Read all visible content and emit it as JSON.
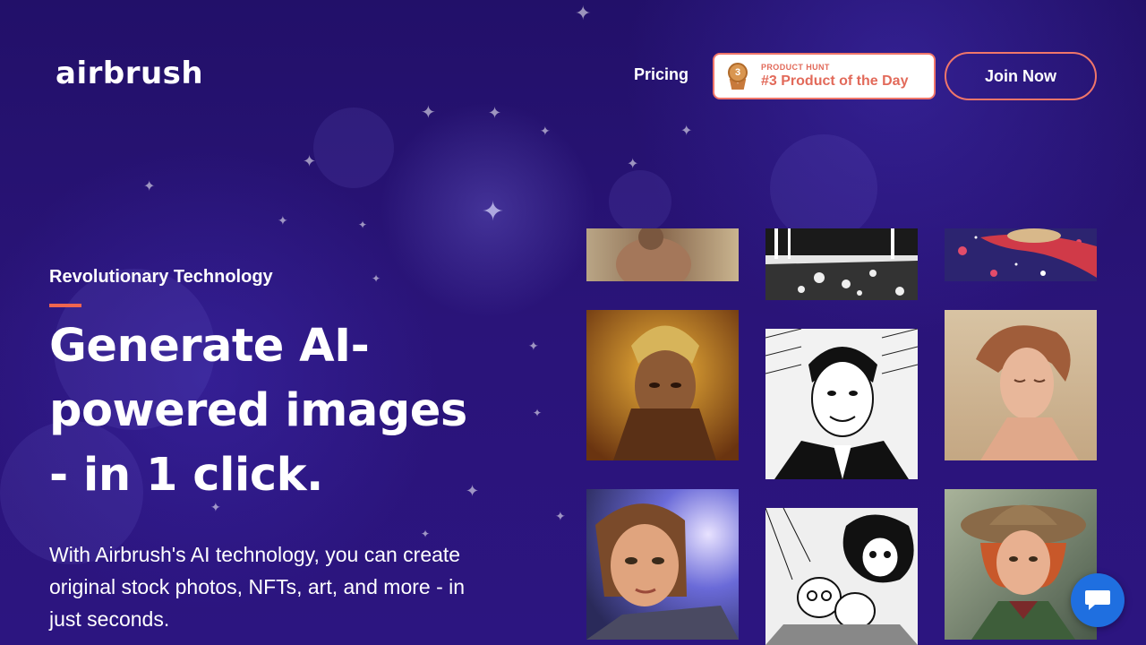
{
  "header": {
    "logo": "airbrush",
    "nav_pricing": "Pricing",
    "product_hunt": {
      "label_small": "PRODUCT HUNT",
      "label_main": "#3 Product of the Day",
      "rank": "3"
    },
    "join_label": "Join Now"
  },
  "hero": {
    "eyebrow": "Revolutionary Technology",
    "headline": "Generate AI-powered images - in 1 click.",
    "subtext": "With Airbrush's AI technology, you can create original stock photos, NFTs, art, and more - in just seconds."
  },
  "gallery": {
    "images": [
      "ai-portrait-bare-shoulder",
      "ai-ink-street-scene",
      "ai-cosmic-reaching-hand",
      "ai-golden-warrior-woman",
      "ai-ink-man-in-suit",
      "ai-woman-with-updo",
      "ai-game-character-heroine",
      "ai-manga-children-sketch",
      "ai-woman-in-hat"
    ]
  },
  "colors": {
    "background": "#24106b",
    "accent": "#f0654f",
    "chat_button": "#1f6fe0"
  }
}
